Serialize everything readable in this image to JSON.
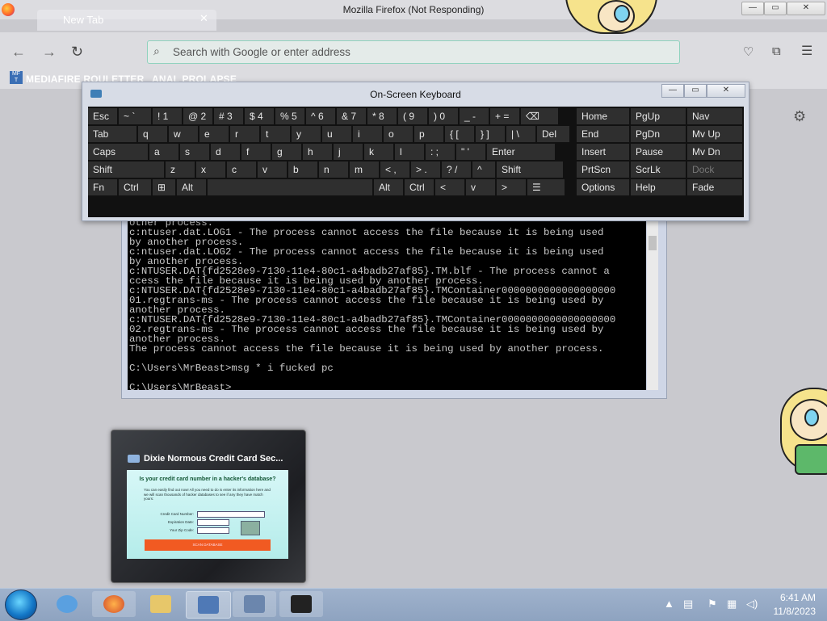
{
  "browser": {
    "window_title": "Mozilla Firefox (Not Responding)",
    "tab_label": "New Tab",
    "address_placeholder": "Search with Google or enter address",
    "bookmarks": [
      {
        "label": "MEDIAFIRE ROULETTER",
        "icon_text": "MF T"
      },
      {
        "label": "ANAL PROLAPSE"
      }
    ],
    "window_buttons": {
      "minimize": "—",
      "maximize": "▭",
      "close": "✕"
    }
  },
  "osk": {
    "title": "On-Screen Keyboard",
    "window_buttons": {
      "minimize": "—",
      "maximize": "▭",
      "close": "✕"
    },
    "rows": [
      [
        {
          "k": "esc",
          "t": "Esc"
        },
        {
          "k": "tilde",
          "t": "~  `"
        },
        {
          "k": "d1",
          "t": "!   1"
        },
        {
          "k": "d2",
          "t": "@  2"
        },
        {
          "k": "d3",
          "t": "#  3"
        },
        {
          "k": "d4",
          "t": "$  4"
        },
        {
          "k": "d5",
          "t": "%  5"
        },
        {
          "k": "d6",
          "t": "^  6"
        },
        {
          "k": "d7",
          "t": "&  7"
        },
        {
          "k": "d8",
          "t": "*   8"
        },
        {
          "k": "d9",
          "t": "(   9"
        },
        {
          "k": "d0",
          "t": ")   0"
        },
        {
          "k": "minus",
          "t": "_  -"
        },
        {
          "k": "equal",
          "t": "+  ="
        },
        {
          "k": "bksp",
          "t": "⌫"
        }
      ],
      [
        {
          "k": "tab",
          "t": "Tab"
        },
        {
          "k": "q",
          "t": "q"
        },
        {
          "k": "w",
          "t": "w"
        },
        {
          "k": "e",
          "t": "e"
        },
        {
          "k": "r",
          "t": "r"
        },
        {
          "k": "t",
          "t": "t"
        },
        {
          "k": "y",
          "t": "y"
        },
        {
          "k": "u",
          "t": "u"
        },
        {
          "k": "i",
          "t": "i"
        },
        {
          "k": "o",
          "t": "o"
        },
        {
          "k": "p",
          "t": "p"
        },
        {
          "k": "lbr",
          "t": "{  ["
        },
        {
          "k": "rbr",
          "t": "}  ]"
        },
        {
          "k": "bslash",
          "t": "|  \\"
        },
        {
          "k": "del",
          "t": "Del"
        }
      ],
      [
        {
          "k": "caps",
          "t": "Caps"
        },
        {
          "k": "a",
          "t": "a"
        },
        {
          "k": "s",
          "t": "s"
        },
        {
          "k": "d",
          "t": "d"
        },
        {
          "k": "f",
          "t": "f"
        },
        {
          "k": "g",
          "t": "g"
        },
        {
          "k": "h",
          "t": "h"
        },
        {
          "k": "j",
          "t": "j"
        },
        {
          "k": "k",
          "t": "k"
        },
        {
          "k": "l",
          "t": "l"
        },
        {
          "k": "semi",
          "t": ":  ;"
        },
        {
          "k": "quote",
          "t": "\"  '"
        },
        {
          "k": "enter",
          "t": "Enter"
        }
      ],
      [
        {
          "k": "shiftl",
          "t": "Shift"
        },
        {
          "k": "z",
          "t": "z"
        },
        {
          "k": "x",
          "t": "x"
        },
        {
          "k": "c",
          "t": "c"
        },
        {
          "k": "v",
          "t": "v"
        },
        {
          "k": "b",
          "t": "b"
        },
        {
          "k": "n",
          "t": "n"
        },
        {
          "k": "m",
          "t": "m"
        },
        {
          "k": "comma",
          "t": "<  ,"
        },
        {
          "k": "period",
          "t": ">  ."
        },
        {
          "k": "slash",
          "t": "?  /"
        },
        {
          "k": "up",
          "t": "^"
        },
        {
          "k": "shiftr",
          "t": "Shift"
        }
      ],
      [
        {
          "k": "fn",
          "t": "Fn"
        },
        {
          "k": "ctrll",
          "t": "Ctrl"
        },
        {
          "k": "win",
          "t": "⊞"
        },
        {
          "k": "altl",
          "t": "Alt"
        },
        {
          "k": "space",
          "t": ""
        },
        {
          "k": "altr",
          "t": "Alt"
        },
        {
          "k": "ctrlr",
          "t": "Ctrl"
        },
        {
          "k": "left",
          "t": "<"
        },
        {
          "k": "down",
          "t": "v"
        },
        {
          "k": "right",
          "t": ">"
        },
        {
          "k": "menu",
          "t": "☰"
        }
      ]
    ],
    "nav_keys": [
      [
        {
          "k": "home",
          "t": "Home"
        },
        {
          "k": "pgup",
          "t": "PgUp"
        },
        {
          "k": "nav",
          "t": "Nav"
        }
      ],
      [
        {
          "k": "end",
          "t": "End"
        },
        {
          "k": "pgdn",
          "t": "PgDn"
        },
        {
          "k": "mvup",
          "t": "Mv Up"
        }
      ],
      [
        {
          "k": "insert",
          "t": "Insert"
        },
        {
          "k": "pause",
          "t": "Pause"
        },
        {
          "k": "mvdn",
          "t": "Mv Dn"
        }
      ],
      [
        {
          "k": "prtscn",
          "t": "PrtScn"
        },
        {
          "k": "scrlk",
          "t": "ScrLk"
        },
        {
          "k": "dock",
          "t": "Dock",
          "dim": true
        }
      ],
      [
        {
          "k": "options",
          "t": "Options"
        },
        {
          "k": "help",
          "t": "Help"
        },
        {
          "k": "fade",
          "t": "Fade"
        }
      ]
    ]
  },
  "console": {
    "lines": [
      "other process.",
      "c:ntuser.dat.LOG1 - The process cannot access the file because it is being used",
      "by another process.",
      "c:ntuser.dat.LOG2 - The process cannot access the file because it is being used",
      "by another process.",
      "c:NTUSER.DAT{fd2528e9-7130-11e4-80c1-a4badb27af85}.TM.blf - The process cannot a",
      "ccess the file because it is being used by another process.",
      "c:NTUSER.DAT{fd2528e9-7130-11e4-80c1-a4badb27af85}.TMContainer0000000000000000000",
      "01.regtrans-ms - The process cannot access the file because it is being used by",
      "another process.",
      "c:NTUSER.DAT{fd2528e9-7130-11e4-80c1-a4badb27af85}.TMContainer0000000000000000000",
      "02.regtrans-ms - The process cannot access the file because it is being used by",
      "another process.",
      "The process cannot access the file because it is being used by another process.",
      "",
      "C:\\Users\\MrBeast>msg * i fucked pc",
      "",
      "C:\\Users\\MrBeast>_"
    ]
  },
  "preview": {
    "window_title": "Dixie Normous Credit Card Sec...",
    "question": "Is your credit card number in a hacker's database?",
    "description": "You can easily find out now! All you need to do is enter its information here and we will scan thousands of hacker databases to see if any they have match yours:",
    "fields": [
      "Credit Card Number:",
      "Expiration Date:",
      "Your Zip Code:"
    ],
    "button": "SCAN DATABASE"
  },
  "taskbar": {
    "time": "6:41 AM",
    "date": "11/8/2023"
  },
  "colors": {
    "osk_key": "#2f2f2f",
    "console_bg": "#000000",
    "scan_button": "#f15a22",
    "taskbar": "#9fb2cc"
  }
}
